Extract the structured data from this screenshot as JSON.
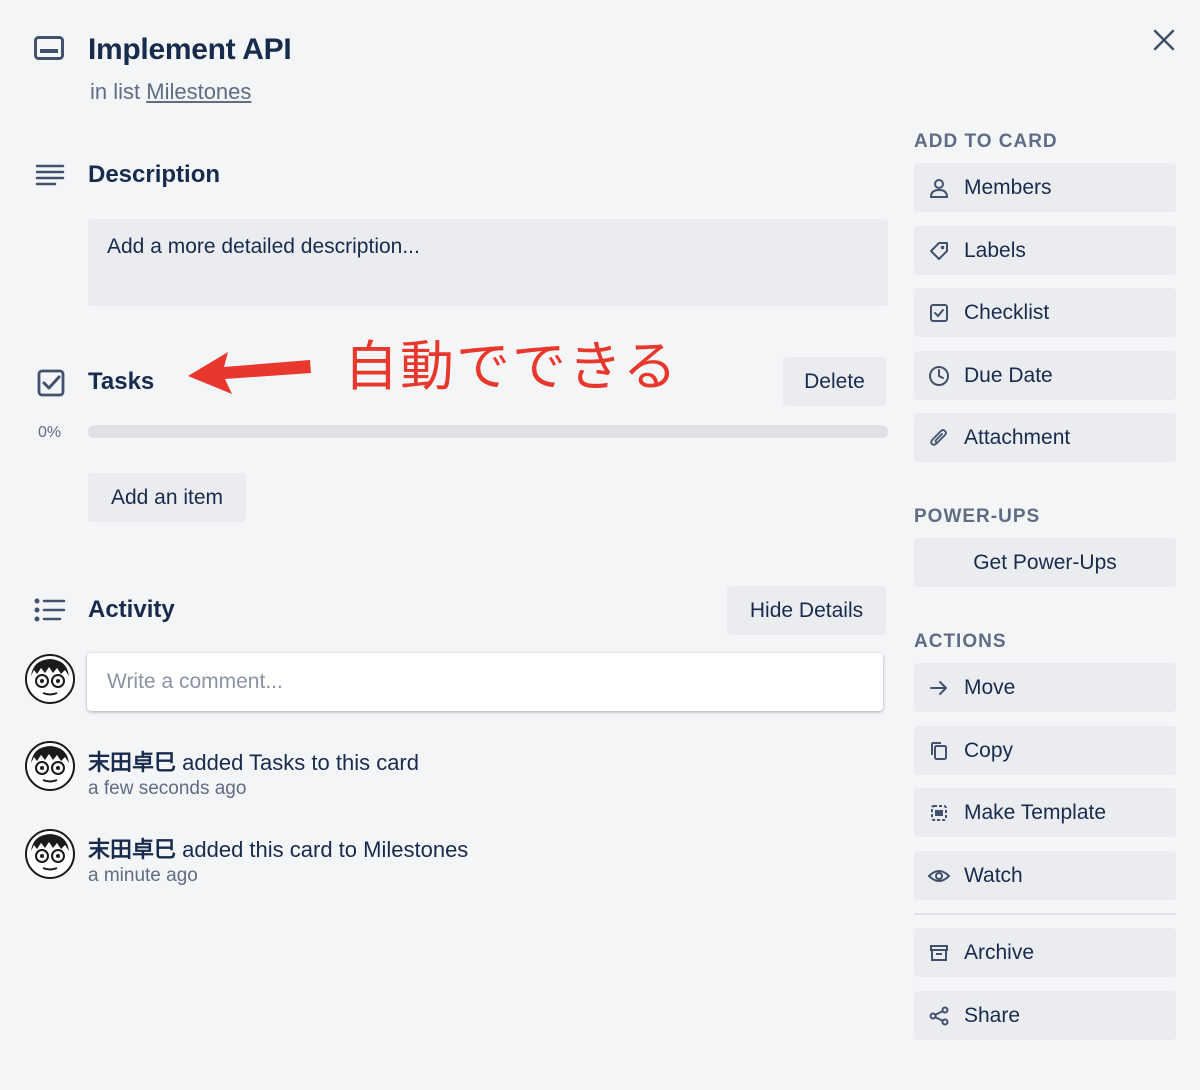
{
  "card": {
    "title": "Implement API",
    "in_list_prefix": "in list",
    "list_name": "Milestones"
  },
  "description": {
    "heading": "Description",
    "placeholder": "Add a more detailed description..."
  },
  "checklist": {
    "heading": "Tasks",
    "delete_label": "Delete",
    "progress_text": "0%",
    "progress_value": 0,
    "add_item_label": "Add an item"
  },
  "annotation": {
    "text": "自動でできる",
    "color": "#e8372c"
  },
  "activity": {
    "heading": "Activity",
    "hide_details_label": "Hide Details",
    "comment_placeholder": "Write a comment...",
    "items": [
      {
        "user": "末田卓巳",
        "action": "added Tasks to this card",
        "time": "a few seconds ago"
      },
      {
        "user": "末田卓巳",
        "action": "added this card to Milestones",
        "time": "a minute ago"
      }
    ]
  },
  "sidebar": {
    "add_to_card_heading": "ADD TO CARD",
    "add_to_card": [
      {
        "label": "Members",
        "icon": "person-icon"
      },
      {
        "label": "Labels",
        "icon": "tag-icon"
      },
      {
        "label": "Checklist",
        "icon": "checkbox-icon"
      },
      {
        "label": "Due Date",
        "icon": "clock-icon"
      },
      {
        "label": "Attachment",
        "icon": "paperclip-icon"
      }
    ],
    "power_ups_heading": "POWER-UPS",
    "get_power_ups_label": "Get Power-Ups",
    "actions_heading": "ACTIONS",
    "actions": [
      {
        "label": "Move",
        "icon": "arrow-right-icon"
      },
      {
        "label": "Copy",
        "icon": "copy-icon"
      },
      {
        "label": "Make Template",
        "icon": "template-icon"
      },
      {
        "label": "Watch",
        "icon": "eye-icon"
      },
      {
        "label": "Archive",
        "icon": "archive-icon"
      },
      {
        "label": "Share",
        "icon": "share-icon"
      }
    ]
  },
  "colors": {
    "background": "#f4f5f7",
    "text": "#172b4d",
    "muted": "#5e6c84",
    "button": "#ebecf0"
  }
}
